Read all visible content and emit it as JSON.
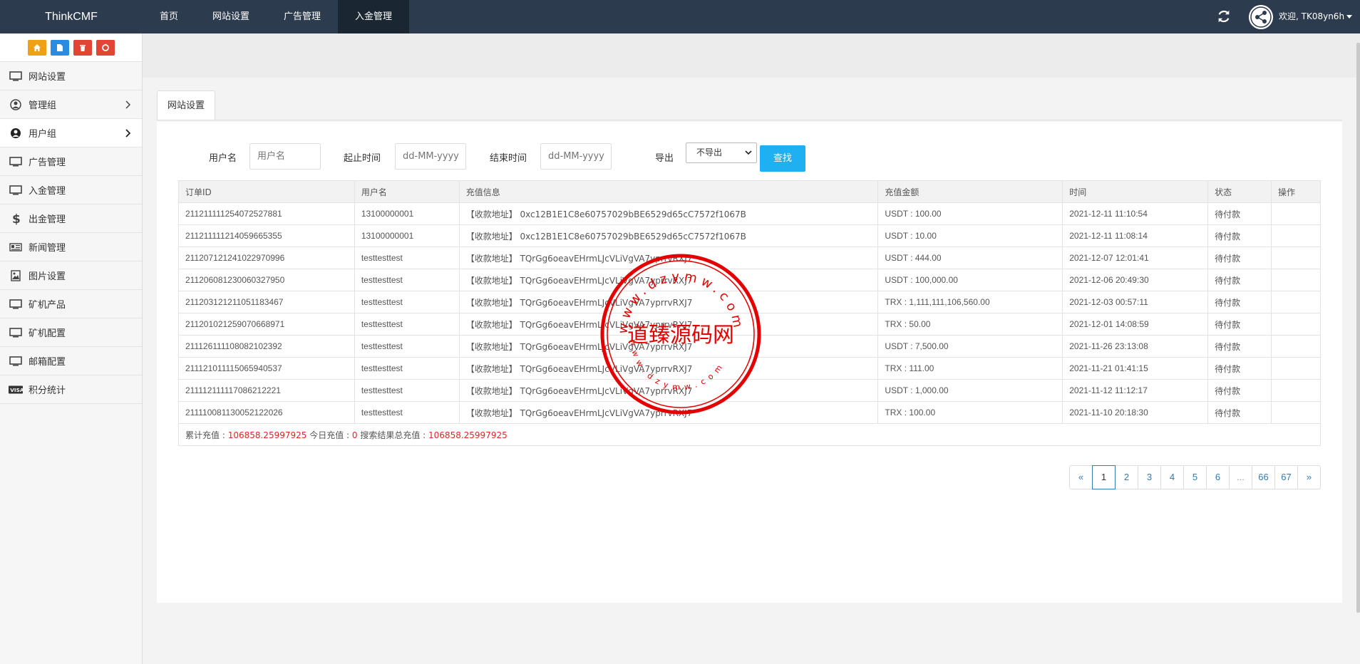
{
  "header": {
    "brand": "ThinkCMF",
    "nav": [
      "首页",
      "网站设置",
      "广告管理",
      "入金管理"
    ],
    "active_nav": 3,
    "welcome": "欢迎, TK08yn6h"
  },
  "sidebar": {
    "shortcut_icons": [
      "home-icon",
      "file-icon",
      "trash-icon",
      "recycle-icon"
    ],
    "items": [
      {
        "label": "网站设置",
        "icon": "monitor-icon"
      },
      {
        "label": "管理组",
        "icon": "user-circle-icon"
      },
      {
        "label": "用户组",
        "icon": "user-icon"
      },
      {
        "label": "广告管理",
        "icon": "monitor-icon"
      },
      {
        "label": "入金管理",
        "icon": "monitor-icon"
      },
      {
        "label": "出金管理",
        "icon": "dollar-icon"
      },
      {
        "label": "新闻管理",
        "icon": "newspaper-icon"
      },
      {
        "label": "图片设置",
        "icon": "image-icon"
      },
      {
        "label": "矿机产品",
        "icon": "monitor-icon"
      },
      {
        "label": "矿机配置",
        "icon": "monitor-icon"
      },
      {
        "label": "邮箱配置",
        "icon": "monitor-icon"
      },
      {
        "label": "积分统计",
        "icon": "visa-icon"
      }
    ]
  },
  "tab": {
    "label": "网站设置"
  },
  "search": {
    "username_label": "用户名",
    "username_placeholder": "用户名",
    "start_label": "起止时间",
    "start_placeholder": "dd-MM-yyyy",
    "end_label": "结束时间",
    "end_placeholder": "dd-MM-yyyy",
    "export_label": "导出",
    "export_value": "不导出",
    "search_button": "查找"
  },
  "table": {
    "headers": [
      "订单ID",
      "用户名",
      "充值信息",
      "充值金额",
      "时间",
      "状态",
      "操作"
    ],
    "rows": [
      {
        "id": "211211111254072527881",
        "user": "13100000001",
        "info": "【收款地址】 0xc12B1E1C8e60757029bBE6529d65cC7572f1067B",
        "amount": "USDT : 100.00",
        "time": "2021-12-11 11:10:54",
        "status": "待付款"
      },
      {
        "id": "211211111214059665355",
        "user": "13100000001",
        "info": "【收款地址】 0xc12B1E1C8e60757029bBE6529d65cC7572f1067B",
        "amount": "USDT : 10.00",
        "time": "2021-12-11 11:08:14",
        "status": "待付款"
      },
      {
        "id": "211207121241022970996",
        "user": "testtesttest",
        "info": "【收款地址】 TQrGg6oeavEHrmLJcVLiVgVA7yprrvRXJ7",
        "amount": "USDT : 444.00",
        "time": "2021-12-07 12:01:41",
        "status": "待付款"
      },
      {
        "id": "211206081230060327950",
        "user": "testtesttest",
        "info": "【收款地址】 TQrGg6oeavEHrmLJcVLiVgVA7yprrvRXJ7",
        "amount": "USDT : 100,000.00",
        "time": "2021-12-06 20:49:30",
        "status": "待付款"
      },
      {
        "id": "211203121211051183467",
        "user": "testtesttest",
        "info": "【收款地址】 TQrGg6oeavEHrmLJcVLiVgVA7yprrvRXJ7",
        "amount": "TRX : 1,111,111,106,560.00",
        "time": "2021-12-03 00:57:11",
        "status": "待付款"
      },
      {
        "id": "211201021259070668971",
        "user": "testtesttest",
        "info": "【收款地址】 TQrGg6oeavEHrmLJcVLiVgVA7yprrvRXJ7",
        "amount": "TRX : 50.00",
        "time": "2021-12-01 14:08:59",
        "status": "待付款"
      },
      {
        "id": "211126111108082102392",
        "user": "testtesttest",
        "info": "【收款地址】 TQrGg6oeavEHrmLJcVLiVgVA7yprrvRXJ7",
        "amount": "USDT : 7,500.00",
        "time": "2021-11-26 23:13:08",
        "status": "待付款"
      },
      {
        "id": "211121011115065940537",
        "user": "testtesttest",
        "info": "【收款地址】 TQrGg6oeavEHrmLJcVLiVgVA7yprrvRXJ7",
        "amount": "TRX : 111.00",
        "time": "2021-11-21 01:41:15",
        "status": "待付款"
      },
      {
        "id": "211112111117086212221",
        "user": "testtesttest",
        "info": "【收款地址】 TQrGg6oeavEHrmLJcVLiVgVA7yprrvRXJ7",
        "amount": "USDT : 1,000.00",
        "time": "2021-11-12 11:12:17",
        "status": "待付款"
      },
      {
        "id": "211110081130052122026",
        "user": "testtesttest",
        "info": "【收款地址】 TQrGg6oeavEHrmLJcVLiVgVA7yprrvRXJ7",
        "amount": "TRX : 100.00",
        "time": "2021-11-10 20:18:30",
        "status": "待付款"
      }
    ]
  },
  "summary": {
    "total_label": "累计充值 : ",
    "total_value": "106858.25997925",
    "today_label": " 今日充值 : ",
    "today_value": "0",
    "result_label": " 搜索结果总充值 : ",
    "result_value": "106858.25997925"
  },
  "pagination": {
    "prev": "«",
    "pages": [
      "1",
      "2",
      "3",
      "4",
      "5",
      "6",
      "...",
      "66",
      "67"
    ],
    "current": "1",
    "next": "»"
  },
  "watermark": {
    "text": "道臻源码网",
    "ring_top": "www.dzymw.com",
    "ring_bottom": "www.dzymw.com"
  },
  "colors": {
    "topbar": "#2c3b4d",
    "accent": "#1eb0f0",
    "link": "#337ab7",
    "red": "#e12626",
    "seal": "#e50000"
  }
}
